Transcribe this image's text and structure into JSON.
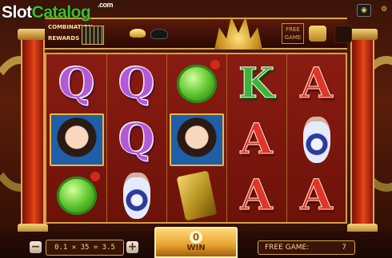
{
  "logo": {
    "word1": "Slot",
    "word2": "Catalog",
    "suffix": ".com"
  },
  "header": {
    "combination_label": "COMBINATION",
    "rewards_label": "REWARDS",
    "free_game_label": "FREE GAME"
  },
  "reels": [
    [
      {
        "symbol": "Q"
      },
      {
        "symbol": "portrait"
      },
      {
        "symbol": "jade"
      }
    ],
    [
      {
        "symbol": "Q"
      },
      {
        "symbol": "Q"
      },
      {
        "symbol": "vase"
      }
    ],
    [
      {
        "symbol": "jade"
      },
      {
        "symbol": "portrait"
      },
      {
        "symbol": "seal"
      }
    ],
    [
      {
        "symbol": "K"
      },
      {
        "symbol": "A"
      },
      {
        "symbol": "A"
      }
    ],
    [
      {
        "symbol": "A"
      },
      {
        "symbol": "vase"
      },
      {
        "symbol": "A"
      }
    ]
  ],
  "bottom": {
    "minus_label": "−",
    "plus_label": "+",
    "bet_display": "0.1 ✕ 35 = 3.5",
    "win_value": "0",
    "win_label": "WIN",
    "free_games_label": "FREE GAME:",
    "free_games_value": "7"
  },
  "colors": {
    "frame_gold": "#d7a649",
    "reel_bg": "#8a1c12",
    "win_panel": "#e7a330"
  }
}
